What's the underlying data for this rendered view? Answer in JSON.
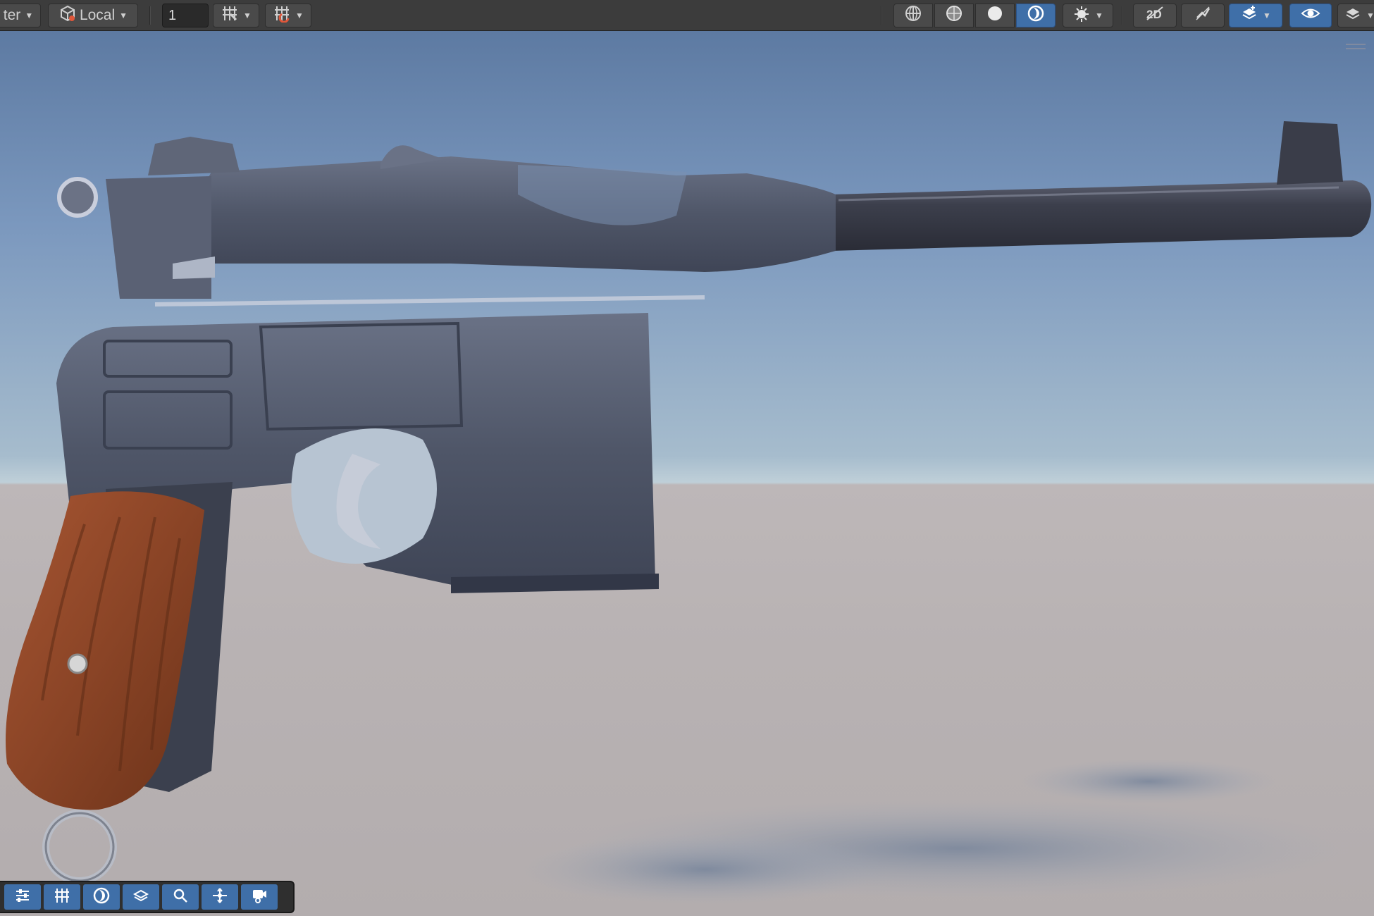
{
  "toolbar": {
    "pivot_partial": "ter",
    "space_label": "Local",
    "grid_size_value": "1",
    "icons": [
      "pivot-dropdown",
      "local-space-icon",
      "grid-snap-icon",
      "increment-snap-icon",
      "wireframe-icon",
      "shaded-wireframe-icon",
      "shaded-icon",
      "lighting-icon",
      "effects-icon",
      "2d-icon",
      "audio-mute-icon",
      "gizmos-icon",
      "visibility-icon",
      "layers-icon"
    ]
  },
  "overlay": {
    "icons": [
      "tool-settings-icon",
      "grid-icon",
      "render-mode-icon",
      "orientation-icon",
      "search-icon",
      "pivot-move-icon",
      "camera-icon"
    ]
  },
  "colors": {
    "accent": "#3f6fa8",
    "toolbar_bg": "#3c3c3c",
    "sky_top": "#5d7aa2",
    "ground": "#b8b2b3",
    "metal": "#4e5565",
    "wood": "#8f4a2a"
  }
}
